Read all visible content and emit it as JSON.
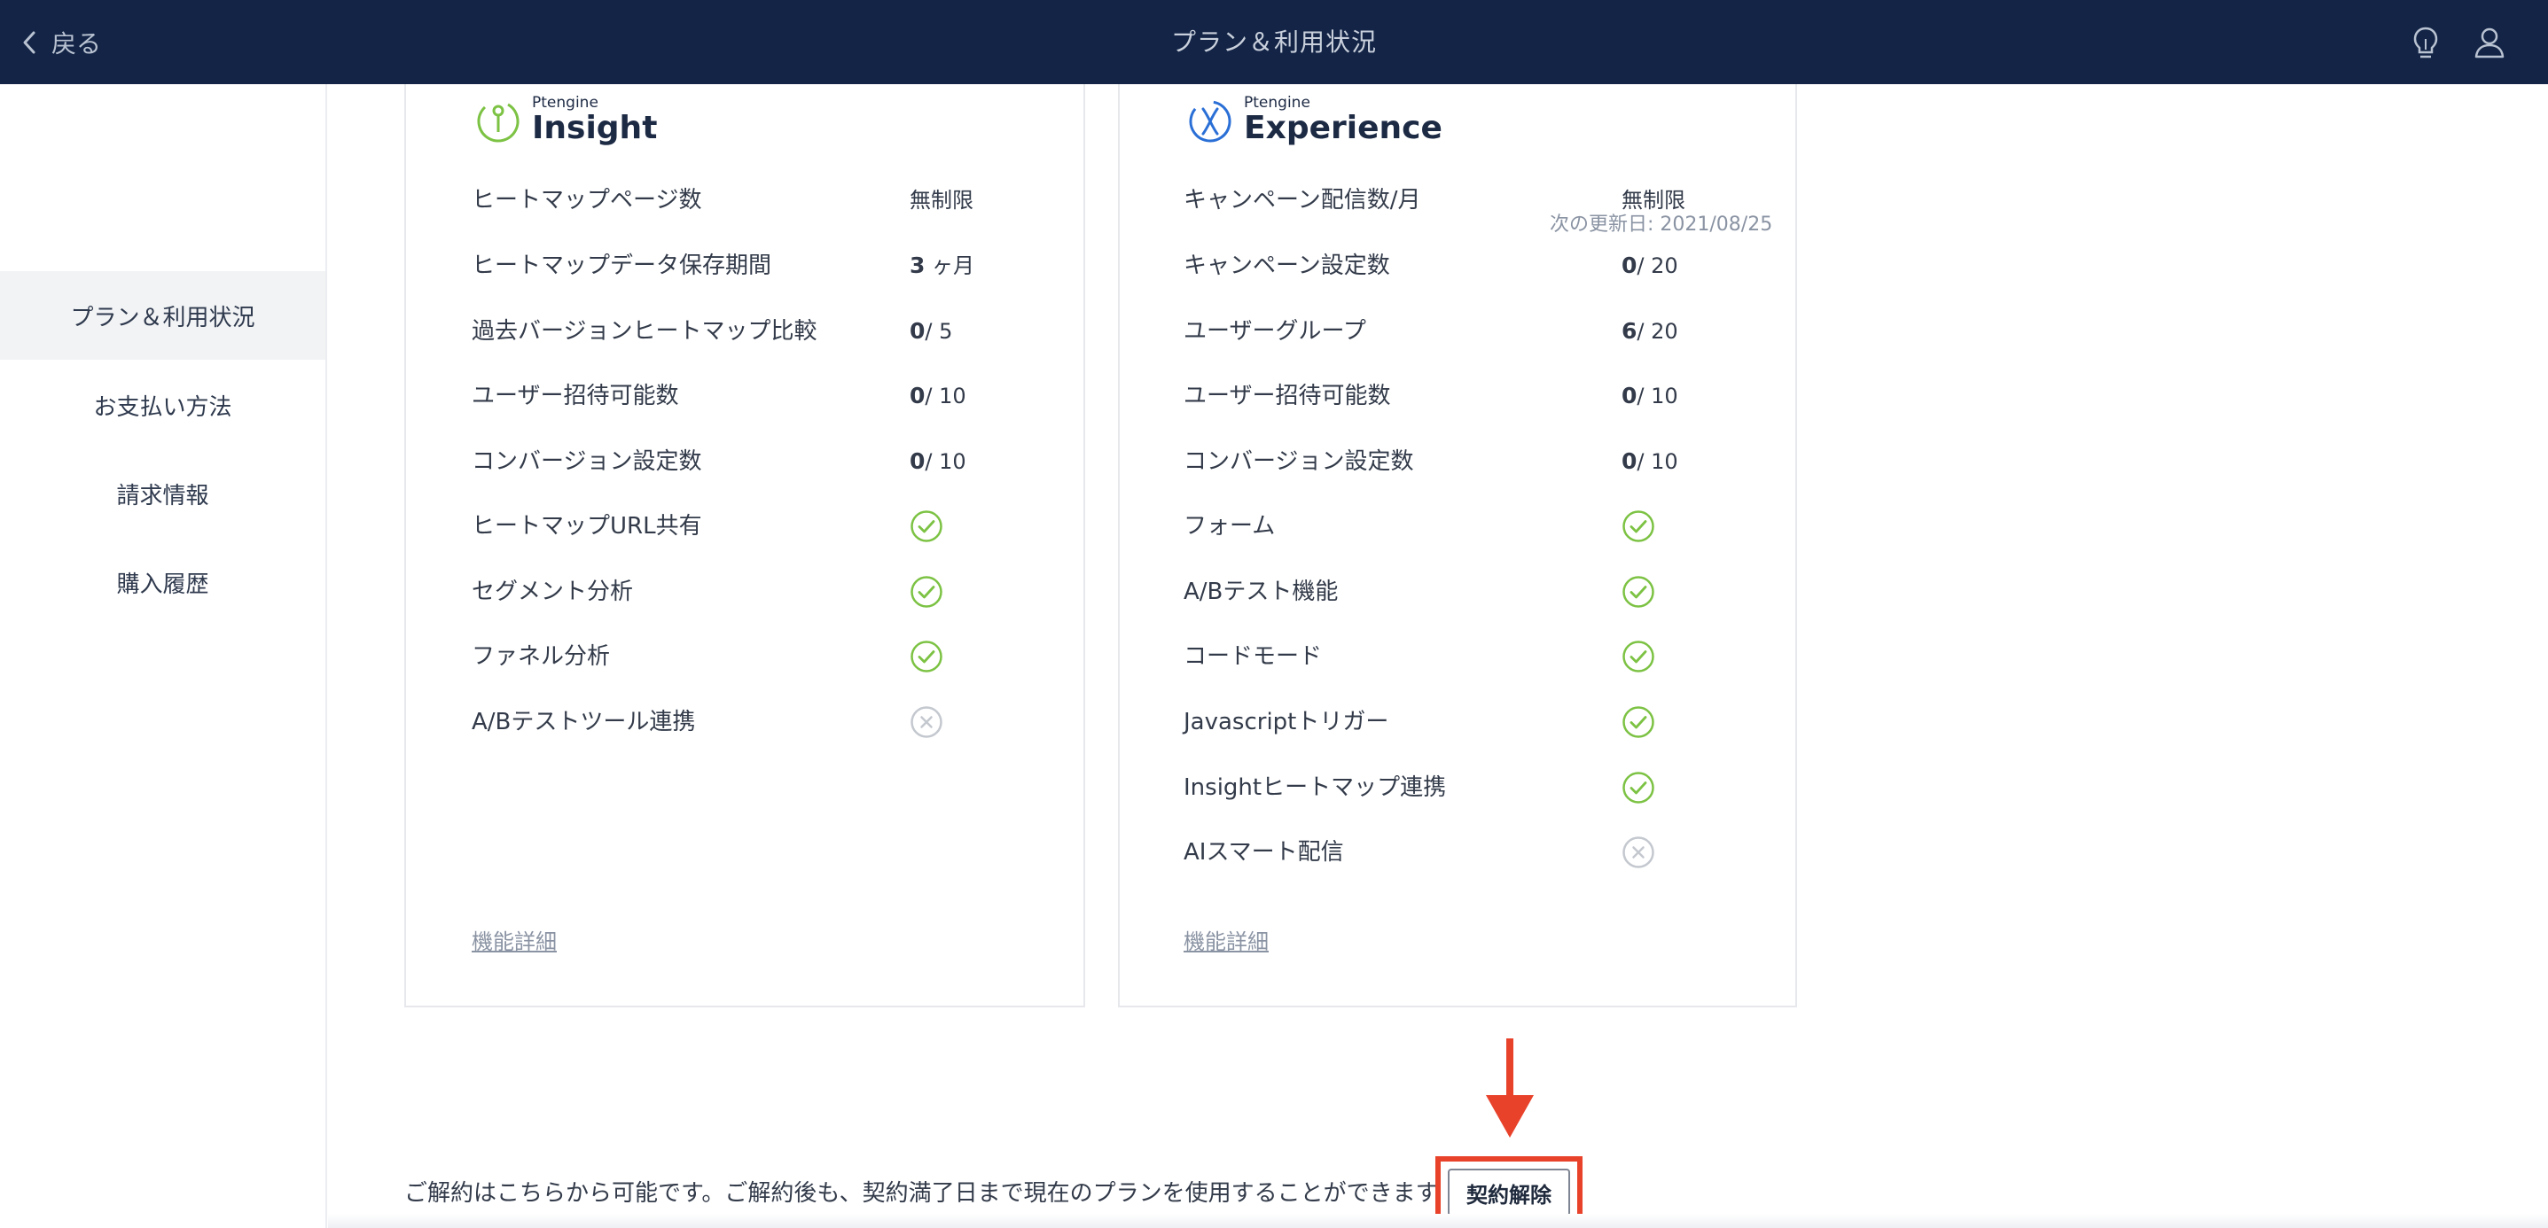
{
  "header": {
    "back_label": "戻る",
    "title": "プラン＆利用状況",
    "bg_color": "#132446"
  },
  "sidebar": {
    "items": [
      {
        "label": "プラン＆利用状況",
        "active": true
      },
      {
        "label": "お支払い方法"
      },
      {
        "label": "請求情報"
      },
      {
        "label": "購入履歴"
      }
    ]
  },
  "insight": {
    "brand": "Ptengine",
    "name": "Insight",
    "rows": [
      {
        "label": "ヒートマップページ数",
        "value": "無制限"
      },
      {
        "label": "ヒートマップデータ保存期間",
        "value_bold": "3",
        "value_rest": " ヶ月"
      },
      {
        "label": "過去バージョンヒートマップ比較",
        "value_bold": "0",
        "value_rest": "/ 5"
      },
      {
        "label": "ユーザー招待可能数",
        "value_bold": "0",
        "value_rest": "/ 10"
      },
      {
        "label": "コンバージョン設定数",
        "value_bold": "0",
        "value_rest": "/ 10"
      },
      {
        "label": "ヒートマップURL共有",
        "status": "check"
      },
      {
        "label": "セグメント分析",
        "status": "check"
      },
      {
        "label": "ファネル分析",
        "status": "check"
      },
      {
        "label": "A/Bテストツール連携",
        "status": "cross"
      }
    ],
    "detail_link": "機能詳細"
  },
  "experience": {
    "brand": "Ptengine",
    "name": "Experience",
    "rows": [
      {
        "label": "キャンペーン配信数/月",
        "value": "無制限",
        "note": "次の更新日: 2021/08/25"
      },
      {
        "label": "キャンペーン設定数",
        "value_bold": "0",
        "value_rest": "/ 20"
      },
      {
        "label": "ユーザーグループ",
        "value_bold": "6",
        "value_rest": "/ 20"
      },
      {
        "label": "ユーザー招待可能数",
        "value_bold": "0",
        "value_rest": "/ 10"
      },
      {
        "label": "コンバージョン設定数",
        "value_bold": "0",
        "value_rest": "/ 10"
      },
      {
        "label": "フォーム",
        "status": "check"
      },
      {
        "label": "A/Bテスト機能",
        "status": "check"
      },
      {
        "label": "コードモード",
        "status": "check"
      },
      {
        "label": "Javascriptトリガー",
        "status": "check"
      },
      {
        "label": "Insightヒートマップ連携",
        "status": "check"
      },
      {
        "label": "AIスマート配信",
        "status": "cross"
      }
    ],
    "detail_link": "機能詳細"
  },
  "footer": {
    "notice": "ご解約はこちらから可能です。ご解約後も、契約満了日まで現在のプランを使用することができます。",
    "cancel_label": "契約解除",
    "highlight_color": "#e8422b"
  },
  "colors": {
    "check": "#7cc243",
    "cross": "#c4c8cf"
  }
}
